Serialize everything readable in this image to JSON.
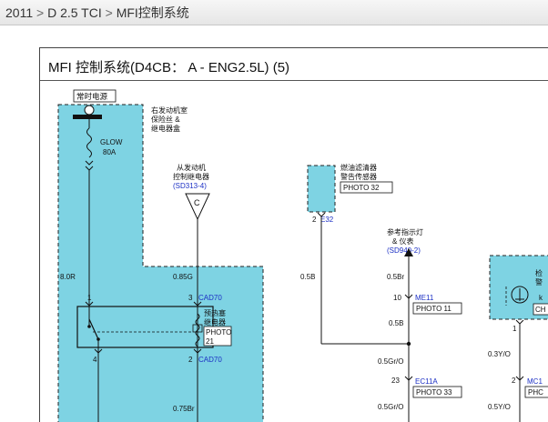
{
  "breadcrumb": {
    "year": "2011",
    "model": "D 2.5 TCI",
    "section": "MFI控制系统",
    "separator": ">"
  },
  "diagram": {
    "title": "MFI 控制系统(D4CB： A - ENG2.5L) (5)",
    "hot_label": "常时电源",
    "fusebox_label": [
      "右发动机室",
      "保险丝 &",
      "继电器盒"
    ],
    "fuse_name": "GLOW",
    "fuse_rating": "80A",
    "ecm_ref": [
      "从发动机",
      "控制继电器"
    ],
    "ecm_ref_code": "(SD313-4)",
    "connector_c": "C",
    "fuel_filter_label": [
      "燃油滤清器",
      "警告传感器"
    ],
    "fuel_filter_photo": "PHOTO 32",
    "fuel_filter_pin": "2",
    "fuel_filter_conn": "E32",
    "indicator_ref": [
      "参考指示灯",
      "& 仪表"
    ],
    "indicator_code": "(SD940-2)",
    "wire_08R": "8.0R",
    "wire_085G": "0.85G",
    "wire_05B_left": "0.5B",
    "wire_05Br": "0.5Br",
    "wire_05B_mid": "0.5B",
    "wire_05GrO_1": "0.5Gr/O",
    "wire_05GrO_2": "0.5Gr/O",
    "wire_075Br": "0.75Br",
    "wire_03YO": "0.3Y/O",
    "wire_05YO": "0.5Y/O",
    "relay_pin1": "1",
    "relay_pin3": "3",
    "relay_pin4": "4",
    "relay_pin2": "2",
    "relay_conn_top": "CAD70",
    "relay_conn_bottom": "CAD70",
    "relay_label": [
      "预热塞",
      "继电器"
    ],
    "relay_photo": "PHOTO",
    "relay_photo_no": "21",
    "me11_pin": "10",
    "me11_conn": "ME11",
    "me11_photo": "PHOTO 11",
    "ec11a_pin": "23",
    "ec11a_conn": "EC11A",
    "ec11a_photo": "PHOTO 33",
    "right_label": [
      "检",
      "警"
    ],
    "right_k": "k",
    "right_ch": "CH",
    "right_pin1": "1",
    "right_pin2": "2",
    "right_mc": "MC1",
    "right_phc": "PHC",
    "colors": {
      "module_fill": "#7ed3e3",
      "link_blue": "#1b2fc4",
      "line": "#111111"
    }
  }
}
